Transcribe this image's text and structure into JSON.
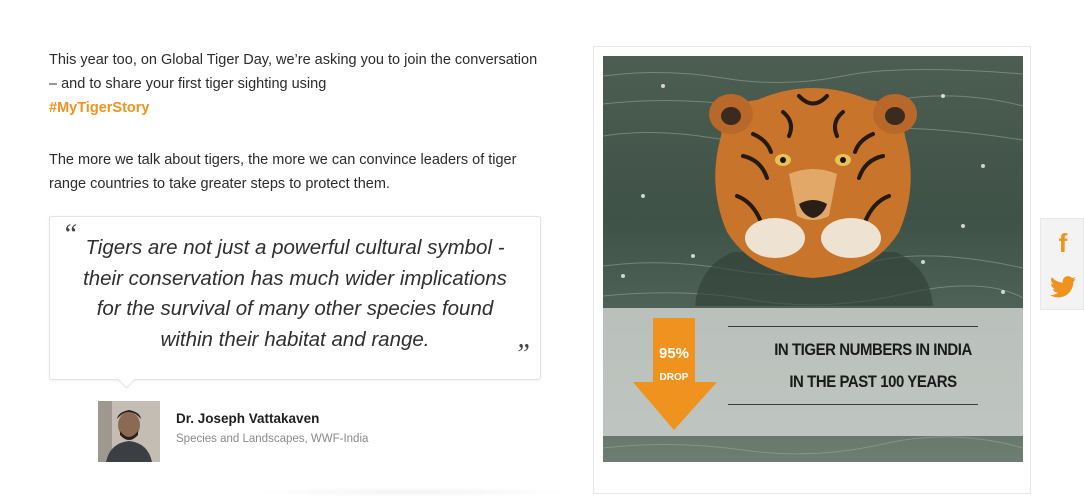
{
  "intro": {
    "line1": "This year too, on Global Tiger Day, we’re asking you to join the conversation – and to share your first tiger sighting using",
    "hashtag": "#MyTigerStory"
  },
  "body": {
    "paragraph": "The more we talk about tigers, the more we can convince leaders of tiger range countries to take greater steps to protect them."
  },
  "quote": {
    "open_mark": "“",
    "text": "Tigers are not just a powerful cultural symbol - their conservation has much wider implications for the survival of many other species found within their habitat and range.",
    "close_mark": "”"
  },
  "author": {
    "name": "Dr. Joseph Vattakaven",
    "role": "Species and Landscapes, WWF-India"
  },
  "infographic": {
    "percent": "95%",
    "drop_label": "DROP",
    "line1": "IN TIGER NUMBERS IN INDIA",
    "line2": "IN THE PAST 100 YEARS",
    "accent_color": "#f0921e"
  },
  "social": {
    "facebook_icon": "facebook-icon",
    "twitter_icon": "twitter-icon",
    "icon_color": "#f0921e"
  }
}
